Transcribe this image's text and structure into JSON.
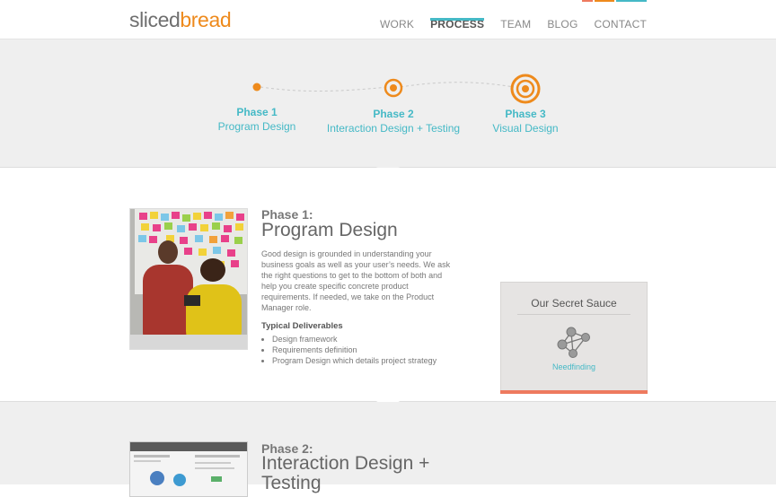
{
  "brand": {
    "logo_part1": "sliced",
    "logo_part2": "bread",
    "accent": "#45b9c6",
    "orange": "#ee8a1c",
    "coral": "#ee7a5f"
  },
  "nav": {
    "items": [
      {
        "label": "WORK"
      },
      {
        "label": "PROCESS",
        "active": true
      },
      {
        "label": "TEAM"
      },
      {
        "label": "BLOG"
      },
      {
        "label": "CONTACT"
      }
    ]
  },
  "timeline": {
    "phases": [
      {
        "number": "Phase 1",
        "name": "Program Design"
      },
      {
        "number": "Phase 2",
        "name": "Interaction Design + Testing"
      },
      {
        "number": "Phase 3",
        "name": "Visual Design"
      }
    ]
  },
  "phase1": {
    "label": "Phase 1:",
    "title": "Program Design",
    "body": "Good design is grounded in understanding your business goals as well as your user’s needs. We ask the right questions to get to the bottom of both and help you create specific concrete product requirements. If needed, we take on the Product Manager role.",
    "deliverables_title": "Typical Deliverables",
    "deliverables": [
      "Design framework",
      "Requirements definition",
      "Program Design which details project strategy"
    ]
  },
  "sauce": {
    "title": "Our Secret Sauce",
    "icon": "network-icon",
    "link": "Needfinding"
  },
  "phase2": {
    "label": "Phase 2:",
    "title_line1": "Interaction Design +",
    "title_line2": "Testing"
  }
}
